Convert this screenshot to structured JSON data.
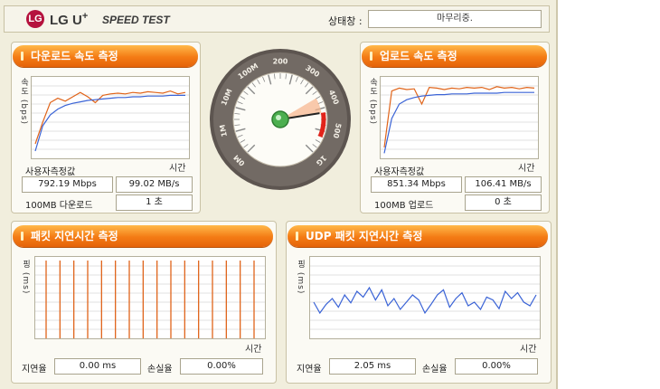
{
  "header": {
    "logo_text": "LG",
    "brand": "LG U",
    "brand_sup": "+",
    "product": "SPEED TEST",
    "status_label": "상태창 :",
    "status_value": "마무리중."
  },
  "download": {
    "title": "다운로드 속도 측정",
    "y_label": "속도 (bps)",
    "x_label": "시간",
    "measured_label": "사용자측정값",
    "mbps": "792.19 Mbps",
    "mbs": "99.02 MB/s",
    "size_label": "100MB 다운로드",
    "time": "1 초"
  },
  "upload": {
    "title": "업로드 속도 측정",
    "y_label": "속도 (bps)",
    "x_label": "시간",
    "measured_label": "사용자측정값",
    "mbps": "851.34 Mbps",
    "mbs": "106.41 MB/s",
    "size_label": "100MB 업로드",
    "time": "0 초"
  },
  "gauge": {
    "labels": [
      "0M",
      "1M",
      "10M",
      "100M",
      "200",
      "300",
      "400",
      "500",
      "1G"
    ]
  },
  "packet": {
    "title": "패킷 지연시간 측정",
    "y_label": "핑 (ms)",
    "x_label": "시간",
    "latency_label": "지연율",
    "latency": "0.00 ms",
    "loss_label": "손실율",
    "loss": "0.00%"
  },
  "udp": {
    "title": "UDP 패킷 지연시간 측정",
    "y_label": "핑 (ms)",
    "x_label": "시간",
    "latency_label": "지연율",
    "latency": "2.05 ms",
    "loss_label": "손실율",
    "loss": "0.00%"
  },
  "colors": {
    "accent": "#f47b14",
    "series_blue": "#3a63d6",
    "series_orange": "#e0641a"
  },
  "chart_data": [
    {
      "type": "line",
      "title": "다운로드 속도 측정",
      "ylabel": "속도 (bps)",
      "xlabel": "시간",
      "x": [
        0,
        1,
        2,
        3,
        4,
        5,
        6,
        7,
        8,
        9,
        10,
        11,
        12,
        13,
        14,
        15,
        16,
        17,
        18,
        19,
        20
      ],
      "series": [
        {
          "values": [
            0.15,
            0.45,
            0.72,
            0.78,
            0.74,
            0.8,
            0.86,
            0.8,
            0.72,
            0.82,
            0.84,
            0.85,
            0.84,
            0.86,
            0.85,
            0.87,
            0.86,
            0.85,
            0.88,
            0.84,
            0.86
          ]
        },
        {
          "values": [
            0.05,
            0.4,
            0.55,
            0.63,
            0.68,
            0.71,
            0.73,
            0.75,
            0.76,
            0.77,
            0.78,
            0.79,
            0.79,
            0.8,
            0.8,
            0.81,
            0.81,
            0.81,
            0.82,
            0.82,
            0.82
          ]
        }
      ]
    },
    {
      "type": "line",
      "title": "업로드 속도 측정",
      "ylabel": "속도 (bps)",
      "xlabel": "시간",
      "x": [
        0,
        1,
        2,
        3,
        4,
        5,
        6,
        7,
        8,
        9,
        10,
        11,
        12,
        13,
        14,
        15,
        16,
        17,
        18,
        19,
        20
      ],
      "series": [
        {
          "values": [
            0.1,
            0.88,
            0.92,
            0.9,
            0.91,
            0.7,
            0.93,
            0.92,
            0.9,
            0.92,
            0.91,
            0.93,
            0.92,
            0.93,
            0.9,
            0.94,
            0.92,
            0.93,
            0.91,
            0.93,
            0.92
          ]
        },
        {
          "values": [
            0.02,
            0.5,
            0.7,
            0.76,
            0.79,
            0.81,
            0.82,
            0.83,
            0.83,
            0.84,
            0.84,
            0.84,
            0.85,
            0.85,
            0.85,
            0.85,
            0.86,
            0.86,
            0.86,
            0.86,
            0.86
          ]
        }
      ]
    },
    {
      "type": "bar",
      "title": "패킷 지연시간 측정",
      "ylabel": "핑 (ms)",
      "xlabel": "시간",
      "x": [
        1,
        2,
        3,
        4,
        5,
        6,
        7,
        8,
        9,
        10,
        11,
        12,
        13,
        14,
        15,
        16
      ],
      "values": [
        1,
        1,
        1,
        1,
        1,
        1,
        1,
        1,
        1,
        1,
        1,
        1,
        1,
        1,
        1,
        1
      ]
    },
    {
      "type": "line",
      "title": "UDP 패킷 지연시간 측정",
      "ylabel": "핑 (ms)",
      "xlabel": "시간",
      "x": [
        0,
        1,
        2,
        3,
        4,
        5,
        6,
        7,
        8,
        9,
        10,
        11,
        12,
        13,
        14,
        15,
        16,
        17,
        18,
        19,
        20,
        21,
        22,
        23,
        24,
        25,
        26,
        27,
        28,
        29,
        30,
        31,
        32,
        33,
        34,
        35,
        36
      ],
      "series": [
        {
          "values": [
            0.45,
            0.3,
            0.42,
            0.5,
            0.38,
            0.55,
            0.44,
            0.6,
            0.52,
            0.65,
            0.48,
            0.62,
            0.4,
            0.5,
            0.35,
            0.45,
            0.55,
            0.48,
            0.3,
            0.42,
            0.55,
            0.62,
            0.38,
            0.5,
            0.58,
            0.4,
            0.45,
            0.35,
            0.52,
            0.48,
            0.36,
            0.6,
            0.5,
            0.58,
            0.45,
            0.4,
            0.55
          ]
        }
      ]
    }
  ]
}
